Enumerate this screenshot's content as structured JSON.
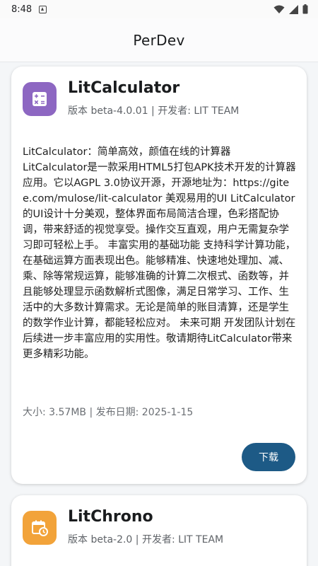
{
  "status": {
    "time": "8:48"
  },
  "app_bar": {
    "title": "PerDev"
  },
  "cards": [
    {
      "name": "LitCalculator",
      "meta": "版本 beta-4.0.01 | 开发者: LIT TEAM",
      "icon": "calculator-icon",
      "icon_color": "#8d67c2",
      "description": "LitCalculator：简单高效，颜值在线的计算器\nLitCalculator是一款采用HTML5打包APK技术开发的计算器应用。它以AGPL 3.0协议开源，开源地址为：https://gitee.com/mulose/lit-calculator 美观易用的UI LitCalculator的UI设计十分美观，整体界面布局简洁合理，色彩搭配协调，带来舒适的视觉享受。操作交互直观，用户无需复杂学习即可轻松上手。 丰富实用的基础功能 支持科学计算功能，在基础运算方面表现出色。能够精准、快速地处理加、减、乘、除等常规运算，能够准确的计算二次根式、函数等，并且能够处理显示函数解析式图像，满足日常学习、工作、生活中的大多数计算需求。无论是简单的账目清算，还是学生的数学作业计算，都能轻松应对。 未来可期 开发团队计划在后续进一步丰富应用的实用性。敬请期待LitCalculator带来更多精彩功能。",
      "size_line": "大小: 3.57MB | 发布日期: 2025-1-15",
      "download_label": "下载"
    },
    {
      "name": "LitChrono",
      "meta": "版本 beta-2.0 | 开发者: LIT TEAM",
      "icon": "calendar-clock-icon",
      "icon_color": "#f2a33a"
    }
  ]
}
